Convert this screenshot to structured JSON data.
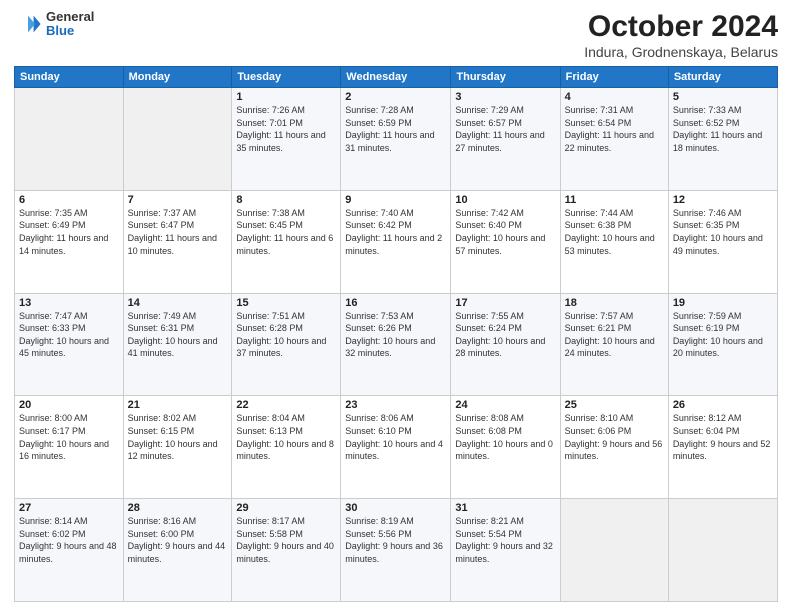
{
  "header": {
    "logo_general": "General",
    "logo_blue": "Blue",
    "title": "October 2024",
    "subtitle": "Indura, Grodnenskaya, Belarus"
  },
  "days_of_week": [
    "Sunday",
    "Monday",
    "Tuesday",
    "Wednesday",
    "Thursday",
    "Friday",
    "Saturday"
  ],
  "weeks": [
    [
      {
        "day": "",
        "info": ""
      },
      {
        "day": "",
        "info": ""
      },
      {
        "day": "1",
        "info": "Sunrise: 7:26 AM\nSunset: 7:01 PM\nDaylight: 11 hours and 35 minutes."
      },
      {
        "day": "2",
        "info": "Sunrise: 7:28 AM\nSunset: 6:59 PM\nDaylight: 11 hours and 31 minutes."
      },
      {
        "day": "3",
        "info": "Sunrise: 7:29 AM\nSunset: 6:57 PM\nDaylight: 11 hours and 27 minutes."
      },
      {
        "day": "4",
        "info": "Sunrise: 7:31 AM\nSunset: 6:54 PM\nDaylight: 11 hours and 22 minutes."
      },
      {
        "day": "5",
        "info": "Sunrise: 7:33 AM\nSunset: 6:52 PM\nDaylight: 11 hours and 18 minutes."
      }
    ],
    [
      {
        "day": "6",
        "info": "Sunrise: 7:35 AM\nSunset: 6:49 PM\nDaylight: 11 hours and 14 minutes."
      },
      {
        "day": "7",
        "info": "Sunrise: 7:37 AM\nSunset: 6:47 PM\nDaylight: 11 hours and 10 minutes."
      },
      {
        "day": "8",
        "info": "Sunrise: 7:38 AM\nSunset: 6:45 PM\nDaylight: 11 hours and 6 minutes."
      },
      {
        "day": "9",
        "info": "Sunrise: 7:40 AM\nSunset: 6:42 PM\nDaylight: 11 hours and 2 minutes."
      },
      {
        "day": "10",
        "info": "Sunrise: 7:42 AM\nSunset: 6:40 PM\nDaylight: 10 hours and 57 minutes."
      },
      {
        "day": "11",
        "info": "Sunrise: 7:44 AM\nSunset: 6:38 PM\nDaylight: 10 hours and 53 minutes."
      },
      {
        "day": "12",
        "info": "Sunrise: 7:46 AM\nSunset: 6:35 PM\nDaylight: 10 hours and 49 minutes."
      }
    ],
    [
      {
        "day": "13",
        "info": "Sunrise: 7:47 AM\nSunset: 6:33 PM\nDaylight: 10 hours and 45 minutes."
      },
      {
        "day": "14",
        "info": "Sunrise: 7:49 AM\nSunset: 6:31 PM\nDaylight: 10 hours and 41 minutes."
      },
      {
        "day": "15",
        "info": "Sunrise: 7:51 AM\nSunset: 6:28 PM\nDaylight: 10 hours and 37 minutes."
      },
      {
        "day": "16",
        "info": "Sunrise: 7:53 AM\nSunset: 6:26 PM\nDaylight: 10 hours and 32 minutes."
      },
      {
        "day": "17",
        "info": "Sunrise: 7:55 AM\nSunset: 6:24 PM\nDaylight: 10 hours and 28 minutes."
      },
      {
        "day": "18",
        "info": "Sunrise: 7:57 AM\nSunset: 6:21 PM\nDaylight: 10 hours and 24 minutes."
      },
      {
        "day": "19",
        "info": "Sunrise: 7:59 AM\nSunset: 6:19 PM\nDaylight: 10 hours and 20 minutes."
      }
    ],
    [
      {
        "day": "20",
        "info": "Sunrise: 8:00 AM\nSunset: 6:17 PM\nDaylight: 10 hours and 16 minutes."
      },
      {
        "day": "21",
        "info": "Sunrise: 8:02 AM\nSunset: 6:15 PM\nDaylight: 10 hours and 12 minutes."
      },
      {
        "day": "22",
        "info": "Sunrise: 8:04 AM\nSunset: 6:13 PM\nDaylight: 10 hours and 8 minutes."
      },
      {
        "day": "23",
        "info": "Sunrise: 8:06 AM\nSunset: 6:10 PM\nDaylight: 10 hours and 4 minutes."
      },
      {
        "day": "24",
        "info": "Sunrise: 8:08 AM\nSunset: 6:08 PM\nDaylight: 10 hours and 0 minutes."
      },
      {
        "day": "25",
        "info": "Sunrise: 8:10 AM\nSunset: 6:06 PM\nDaylight: 9 hours and 56 minutes."
      },
      {
        "day": "26",
        "info": "Sunrise: 8:12 AM\nSunset: 6:04 PM\nDaylight: 9 hours and 52 minutes."
      }
    ],
    [
      {
        "day": "27",
        "info": "Sunrise: 8:14 AM\nSunset: 6:02 PM\nDaylight: 9 hours and 48 minutes."
      },
      {
        "day": "28",
        "info": "Sunrise: 8:16 AM\nSunset: 6:00 PM\nDaylight: 9 hours and 44 minutes."
      },
      {
        "day": "29",
        "info": "Sunrise: 8:17 AM\nSunset: 5:58 PM\nDaylight: 9 hours and 40 minutes."
      },
      {
        "day": "30",
        "info": "Sunrise: 8:19 AM\nSunset: 5:56 PM\nDaylight: 9 hours and 36 minutes."
      },
      {
        "day": "31",
        "info": "Sunrise: 8:21 AM\nSunset: 5:54 PM\nDaylight: 9 hours and 32 minutes."
      },
      {
        "day": "",
        "info": ""
      },
      {
        "day": "",
        "info": ""
      }
    ]
  ]
}
